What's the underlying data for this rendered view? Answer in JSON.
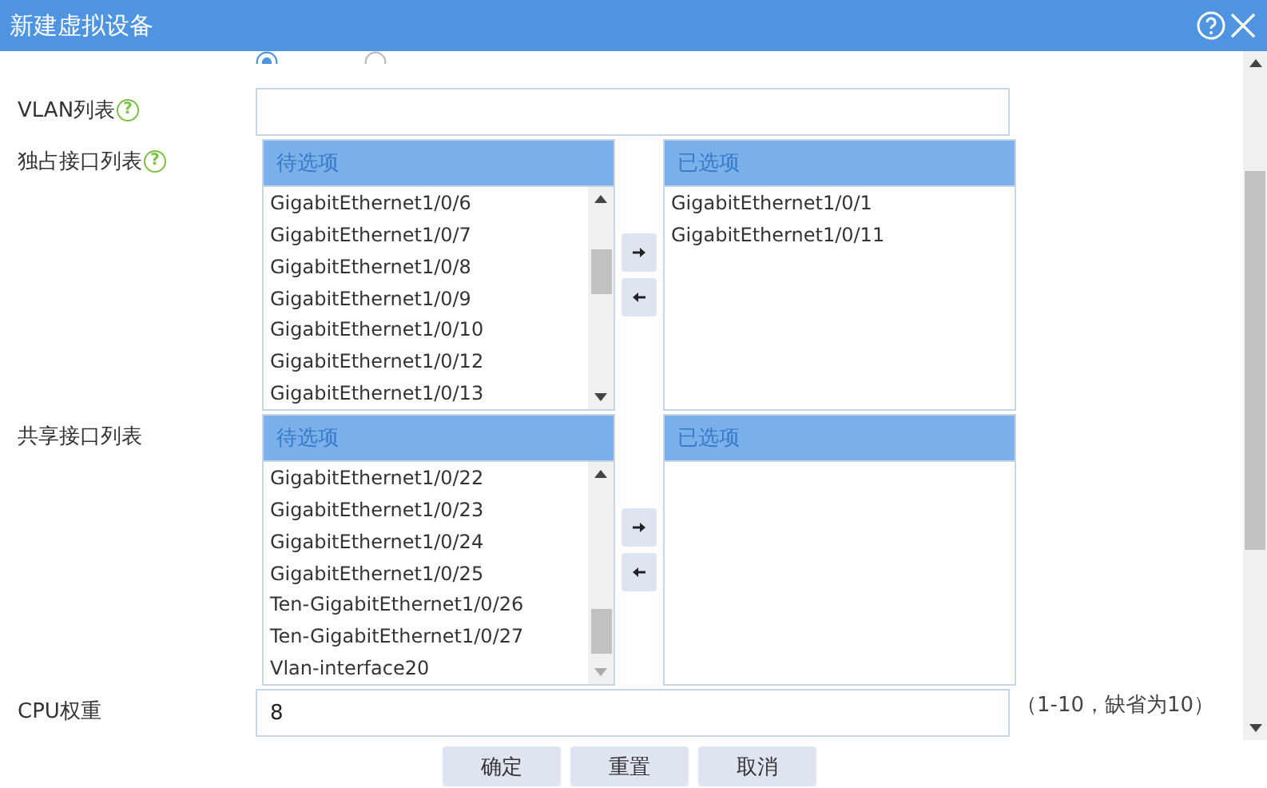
{
  "window": {
    "title": "新建虚拟设备"
  },
  "mode_radios": [
    {
      "selected": true
    },
    {
      "selected": false
    }
  ],
  "rows": [
    {
      "kind": "text",
      "label": "VLAN列表",
      "help": "?",
      "value": ""
    },
    {
      "kind": "transfer",
      "label": "独占接口列表",
      "help": "?",
      "available_title": "待选项",
      "selected_title": "已选项",
      "available": [
        "GigabitEthernet1/0/6",
        "GigabitEthernet1/0/7",
        "GigabitEthernet1/0/8",
        "GigabitEthernet1/0/9",
        "GigabitEthernet1/0/10",
        "GigabitEthernet1/0/12",
        "GigabitEthernet1/0/13"
      ],
      "chosen": [
        "GigabitEthernet1/0/1",
        "GigabitEthernet1/0/11"
      ]
    },
    {
      "kind": "transfer",
      "label": "共享接口列表",
      "available_title": "待选项",
      "selected_title": "已选项",
      "available": [
        "GigabitEthernet1/0/22",
        "GigabitEthernet1/0/23",
        "GigabitEthernet1/0/24",
        "GigabitEthernet1/0/25",
        "Ten-GigabitEthernet1/0/26",
        "Ten-GigabitEthernet1/0/27",
        "Vlan-interface20"
      ],
      "chosen": []
    },
    {
      "kind": "text",
      "label": "CPU权重",
      "value": "8",
      "hint": "（1-10，缺省为10）"
    }
  ],
  "buttons": [
    "确定",
    "重置",
    "取消"
  ]
}
